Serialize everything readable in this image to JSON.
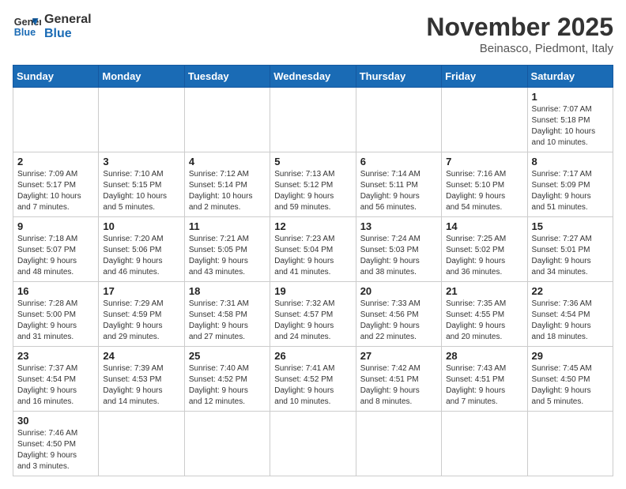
{
  "header": {
    "logo_line1": "General",
    "logo_line2": "Blue",
    "month_title": "November 2025",
    "location": "Beinasco, Piedmont, Italy"
  },
  "weekdays": [
    "Sunday",
    "Monday",
    "Tuesday",
    "Wednesday",
    "Thursday",
    "Friday",
    "Saturday"
  ],
  "weeks": [
    [
      {
        "day": "",
        "info": ""
      },
      {
        "day": "",
        "info": ""
      },
      {
        "day": "",
        "info": ""
      },
      {
        "day": "",
        "info": ""
      },
      {
        "day": "",
        "info": ""
      },
      {
        "day": "",
        "info": ""
      },
      {
        "day": "1",
        "info": "Sunrise: 7:07 AM\nSunset: 5:18 PM\nDaylight: 10 hours\nand 10 minutes."
      }
    ],
    [
      {
        "day": "2",
        "info": "Sunrise: 7:09 AM\nSunset: 5:17 PM\nDaylight: 10 hours\nand 7 minutes."
      },
      {
        "day": "3",
        "info": "Sunrise: 7:10 AM\nSunset: 5:15 PM\nDaylight: 10 hours\nand 5 minutes."
      },
      {
        "day": "4",
        "info": "Sunrise: 7:12 AM\nSunset: 5:14 PM\nDaylight: 10 hours\nand 2 minutes."
      },
      {
        "day": "5",
        "info": "Sunrise: 7:13 AM\nSunset: 5:12 PM\nDaylight: 9 hours\nand 59 minutes."
      },
      {
        "day": "6",
        "info": "Sunrise: 7:14 AM\nSunset: 5:11 PM\nDaylight: 9 hours\nand 56 minutes."
      },
      {
        "day": "7",
        "info": "Sunrise: 7:16 AM\nSunset: 5:10 PM\nDaylight: 9 hours\nand 54 minutes."
      },
      {
        "day": "8",
        "info": "Sunrise: 7:17 AM\nSunset: 5:09 PM\nDaylight: 9 hours\nand 51 minutes."
      }
    ],
    [
      {
        "day": "9",
        "info": "Sunrise: 7:18 AM\nSunset: 5:07 PM\nDaylight: 9 hours\nand 48 minutes."
      },
      {
        "day": "10",
        "info": "Sunrise: 7:20 AM\nSunset: 5:06 PM\nDaylight: 9 hours\nand 46 minutes."
      },
      {
        "day": "11",
        "info": "Sunrise: 7:21 AM\nSunset: 5:05 PM\nDaylight: 9 hours\nand 43 minutes."
      },
      {
        "day": "12",
        "info": "Sunrise: 7:23 AM\nSunset: 5:04 PM\nDaylight: 9 hours\nand 41 minutes."
      },
      {
        "day": "13",
        "info": "Sunrise: 7:24 AM\nSunset: 5:03 PM\nDaylight: 9 hours\nand 38 minutes."
      },
      {
        "day": "14",
        "info": "Sunrise: 7:25 AM\nSunset: 5:02 PM\nDaylight: 9 hours\nand 36 minutes."
      },
      {
        "day": "15",
        "info": "Sunrise: 7:27 AM\nSunset: 5:01 PM\nDaylight: 9 hours\nand 34 minutes."
      }
    ],
    [
      {
        "day": "16",
        "info": "Sunrise: 7:28 AM\nSunset: 5:00 PM\nDaylight: 9 hours\nand 31 minutes."
      },
      {
        "day": "17",
        "info": "Sunrise: 7:29 AM\nSunset: 4:59 PM\nDaylight: 9 hours\nand 29 minutes."
      },
      {
        "day": "18",
        "info": "Sunrise: 7:31 AM\nSunset: 4:58 PM\nDaylight: 9 hours\nand 27 minutes."
      },
      {
        "day": "19",
        "info": "Sunrise: 7:32 AM\nSunset: 4:57 PM\nDaylight: 9 hours\nand 24 minutes."
      },
      {
        "day": "20",
        "info": "Sunrise: 7:33 AM\nSunset: 4:56 PM\nDaylight: 9 hours\nand 22 minutes."
      },
      {
        "day": "21",
        "info": "Sunrise: 7:35 AM\nSunset: 4:55 PM\nDaylight: 9 hours\nand 20 minutes."
      },
      {
        "day": "22",
        "info": "Sunrise: 7:36 AM\nSunset: 4:54 PM\nDaylight: 9 hours\nand 18 minutes."
      }
    ],
    [
      {
        "day": "23",
        "info": "Sunrise: 7:37 AM\nSunset: 4:54 PM\nDaylight: 9 hours\nand 16 minutes."
      },
      {
        "day": "24",
        "info": "Sunrise: 7:39 AM\nSunset: 4:53 PM\nDaylight: 9 hours\nand 14 minutes."
      },
      {
        "day": "25",
        "info": "Sunrise: 7:40 AM\nSunset: 4:52 PM\nDaylight: 9 hours\nand 12 minutes."
      },
      {
        "day": "26",
        "info": "Sunrise: 7:41 AM\nSunset: 4:52 PM\nDaylight: 9 hours\nand 10 minutes."
      },
      {
        "day": "27",
        "info": "Sunrise: 7:42 AM\nSunset: 4:51 PM\nDaylight: 9 hours\nand 8 minutes."
      },
      {
        "day": "28",
        "info": "Sunrise: 7:43 AM\nSunset: 4:51 PM\nDaylight: 9 hours\nand 7 minutes."
      },
      {
        "day": "29",
        "info": "Sunrise: 7:45 AM\nSunset: 4:50 PM\nDaylight: 9 hours\nand 5 minutes."
      }
    ],
    [
      {
        "day": "30",
        "info": "Sunrise: 7:46 AM\nSunset: 4:50 PM\nDaylight: 9 hours\nand 3 minutes."
      },
      {
        "day": "",
        "info": ""
      },
      {
        "day": "",
        "info": ""
      },
      {
        "day": "",
        "info": ""
      },
      {
        "day": "",
        "info": ""
      },
      {
        "day": "",
        "info": ""
      },
      {
        "day": "",
        "info": ""
      }
    ]
  ]
}
